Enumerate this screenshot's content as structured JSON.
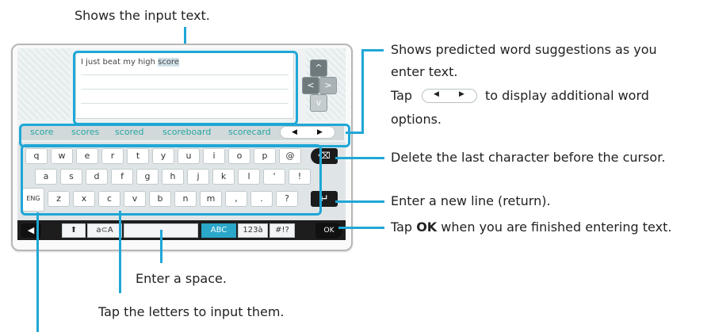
{
  "annotations": {
    "input_text": "Shows the input text.",
    "predicted_1": "Shows predicted word suggestions as you",
    "predicted_2": "enter text.",
    "tap_prefix": "Tap",
    "tap_suffix": "to display additional word",
    "tap_line2": "options.",
    "delete": "Delete the last character before the cursor.",
    "newline": "Enter a new line (return).",
    "ok_prefix": "Tap",
    "ok_bold": "OK",
    "ok_suffix": "when you are finished entering text.",
    "space": "Enter a space.",
    "letters": "Tap the letters to input them."
  },
  "input": {
    "text_before": "I just beat my high ",
    "text_highlight": "score"
  },
  "suggestions": [
    "score",
    "scores",
    "scored",
    "scoreboard",
    "scorecard"
  ],
  "keyboard": {
    "row1": [
      "q",
      "w",
      "e",
      "r",
      "t",
      "y",
      "u",
      "i",
      "o",
      "p",
      "@"
    ],
    "row2": [
      "a",
      "s",
      "d",
      "f",
      "g",
      "h",
      "j",
      "k",
      "l",
      "'",
      "!"
    ],
    "row3": [
      "z",
      "x",
      "c",
      "v",
      "b",
      "n",
      "m",
      ",",
      ".",
      "?"
    ],
    "lang_label": "ENG",
    "shift": "⬆",
    "case_toggle": "a⊂A",
    "mode_abc": "ABC",
    "mode_num": "123à",
    "mode_sym": "#!?",
    "ok_label": "OK"
  },
  "icons": {
    "arrow_left": "◀",
    "arrow_right": "▶",
    "up": "^",
    "left": "<",
    "right": ">",
    "down": "v",
    "back": "◀",
    "backspace": "⌫",
    "return": "↵"
  },
  "colors": {
    "accent": "#1fa7d6",
    "suggestion_text": "#25a6a0",
    "abc_mode": "#2aa7c9"
  }
}
